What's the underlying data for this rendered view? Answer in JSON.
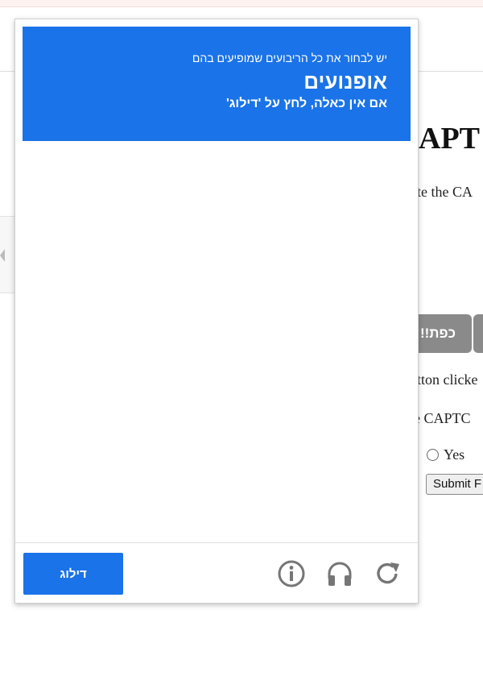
{
  "background": {
    "heading": "APT",
    "line1": "ete the CA",
    "pill_label": "!!כפת",
    "line2": "tton clicke",
    "line3": "e CAPTC",
    "radio_label": "Yes",
    "submit_label": "Submit F"
  },
  "captcha": {
    "instruction": "יש לבחור את כל הריבועים שמופיעים בהם",
    "target": "אופנועים",
    "subtext": "אם אין כאלה, לחץ על 'דילוג'",
    "skip_label": "דילוג",
    "grid": {
      "rows": 4,
      "cols": 4
    },
    "icons": [
      "info-icon",
      "headphones-icon",
      "reload-icon"
    ],
    "colors": {
      "accent": "#1a73e8",
      "icon": "#767676"
    }
  }
}
